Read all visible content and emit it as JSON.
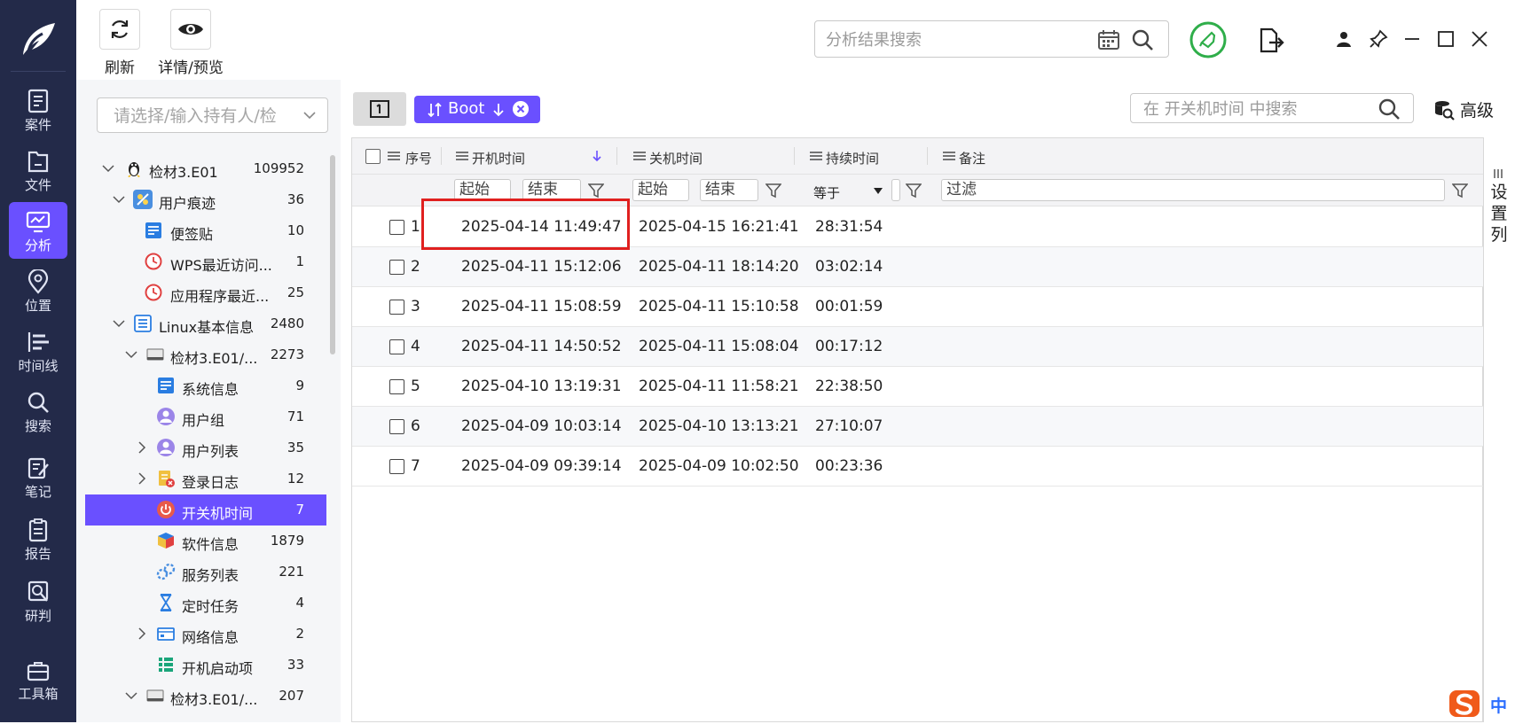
{
  "nav": {
    "items": [
      {
        "label": "案件",
        "icon": "case-icon"
      },
      {
        "label": "文件",
        "icon": "file-icon"
      },
      {
        "label": "分析",
        "icon": "analysis-icon",
        "active": true
      },
      {
        "label": "位置",
        "icon": "location-icon"
      },
      {
        "label": "时间线",
        "icon": "timeline-icon"
      },
      {
        "label": "搜索",
        "icon": "search-icon"
      },
      {
        "label": "笔记",
        "icon": "notes-icon"
      },
      {
        "label": "报告",
        "icon": "report-icon"
      },
      {
        "label": "研判",
        "icon": "judge-icon"
      },
      {
        "label": "工具箱",
        "icon": "toolbox-icon"
      }
    ],
    "accent_color": "#6a50ff",
    "background_color": "#232a49"
  },
  "toolbar": {
    "refresh_label": "刷新",
    "preview_label": "详情/预览"
  },
  "top_search": {
    "placeholder": "分析结果搜索"
  },
  "sidebar": {
    "owner_placeholder": "请选择/输入持有人/检",
    "tree": [
      {
        "label": "检材3.E01",
        "count": "109952",
        "icon": "linux-icon"
      },
      {
        "label": "用户痕迹",
        "count": "36",
        "icon": "user-trace-icon"
      },
      {
        "label": "便签贴",
        "count": "10",
        "icon": "sticky-note-icon"
      },
      {
        "label": "WPS最近访问...",
        "count": "1",
        "icon": "recent-clock-icon"
      },
      {
        "label": "应用程序最近...",
        "count": "25",
        "icon": "recent-clock-icon"
      },
      {
        "label": "Linux基本信息",
        "count": "2480",
        "icon": "list-icon"
      },
      {
        "label": "检材3.E01/...",
        "count": "2273",
        "icon": "disk-icon"
      },
      {
        "label": "系统信息",
        "count": "9",
        "icon": "system-info-icon"
      },
      {
        "label": "用户组",
        "count": "71",
        "icon": "user-group-icon"
      },
      {
        "label": "用户列表",
        "count": "35",
        "icon": "user-list-icon"
      },
      {
        "label": "登录日志",
        "count": "12",
        "icon": "login-log-icon"
      },
      {
        "label": "开关机时间",
        "count": "7",
        "icon": "power-icon",
        "selected": true
      },
      {
        "label": "软件信息",
        "count": "1879",
        "icon": "software-icon"
      },
      {
        "label": "服务列表",
        "count": "221",
        "icon": "service-icon"
      },
      {
        "label": "定时任务",
        "count": "4",
        "icon": "hourglass-icon"
      },
      {
        "label": "网络信息",
        "count": "2",
        "icon": "network-icon"
      },
      {
        "label": "开机启动项",
        "count": "33",
        "icon": "startup-icon"
      },
      {
        "label": "检材3.E01/...",
        "count": "207",
        "icon": "disk-icon"
      }
    ]
  },
  "filterbar": {
    "chip_label": "Boot",
    "column_search_placeholder": "在 开关机时间 中搜索",
    "advanced_label": "高级"
  },
  "grid": {
    "columns": [
      "序号",
      "开机时间",
      "关机时间",
      "持续时间",
      "备注"
    ],
    "filters": {
      "start": "起始",
      "end": "结束",
      "start2": "起始",
      "end2": "结束",
      "equals": "等于",
      "filter": "过滤"
    },
    "rows": [
      {
        "no": "1",
        "boot": "2025-04-14 11:49:47",
        "shutdown": "2025-04-15 16:21:41",
        "duration": "28:31:54",
        "note": ""
      },
      {
        "no": "2",
        "boot": "2025-04-11 15:12:06",
        "shutdown": "2025-04-11 18:14:20",
        "duration": "03:02:14",
        "note": ""
      },
      {
        "no": "3",
        "boot": "2025-04-11 15:08:59",
        "shutdown": "2025-04-11 15:10:58",
        "duration": "00:01:59",
        "note": ""
      },
      {
        "no": "4",
        "boot": "2025-04-11 14:50:52",
        "shutdown": "2025-04-11 15:08:04",
        "duration": "00:17:12",
        "note": ""
      },
      {
        "no": "5",
        "boot": "2025-04-10 13:19:31",
        "shutdown": "2025-04-11 11:58:21",
        "duration": "22:38:50",
        "note": ""
      },
      {
        "no": "6",
        "boot": "2025-04-09 10:03:14",
        "shutdown": "2025-04-10 13:13:21",
        "duration": "27:10:07",
        "note": ""
      },
      {
        "no": "7",
        "boot": "2025-04-09 09:39:14",
        "shutdown": "2025-04-09 10:02:50",
        "duration": "00:23:36",
        "note": ""
      }
    ],
    "settings_label": "设置列",
    "highlight_color": "#e0201f"
  },
  "ime": {
    "mode_label": "中"
  }
}
